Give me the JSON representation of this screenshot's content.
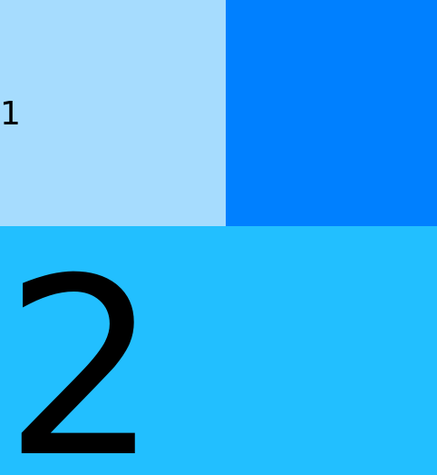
{
  "colors": {
    "panel_light": "#a6dcfe",
    "panel_blue": "#0080ff",
    "panel_cyan": "#22bfff",
    "text": "#000000"
  },
  "panels": {
    "top_left": {
      "label": "1"
    },
    "top_right": {
      "label": ""
    },
    "bottom": {
      "label": "2"
    }
  }
}
